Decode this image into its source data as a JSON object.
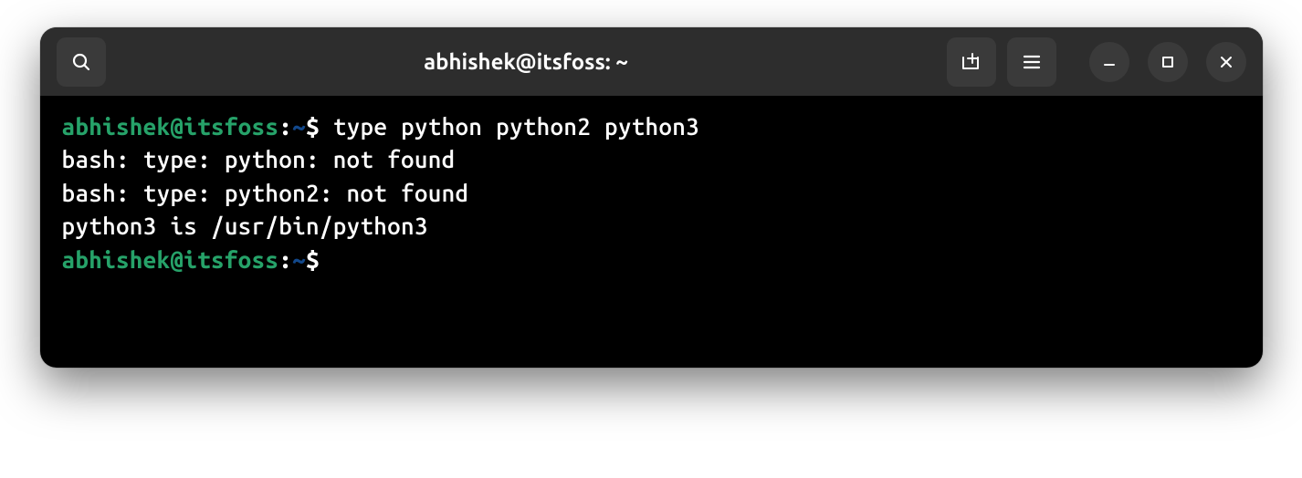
{
  "titlebar": {
    "title": "abhishek@itsfoss: ~"
  },
  "prompt": {
    "user_host": "abhishek@itsfoss",
    "sep": ":",
    "path": "~",
    "symbol": "$"
  },
  "session": {
    "command1": "type python python2 python3",
    "output1": "bash: type: python: not found",
    "output2": "bash: type: python2: not found",
    "output3": "python3 is /usr/bin/python3"
  }
}
